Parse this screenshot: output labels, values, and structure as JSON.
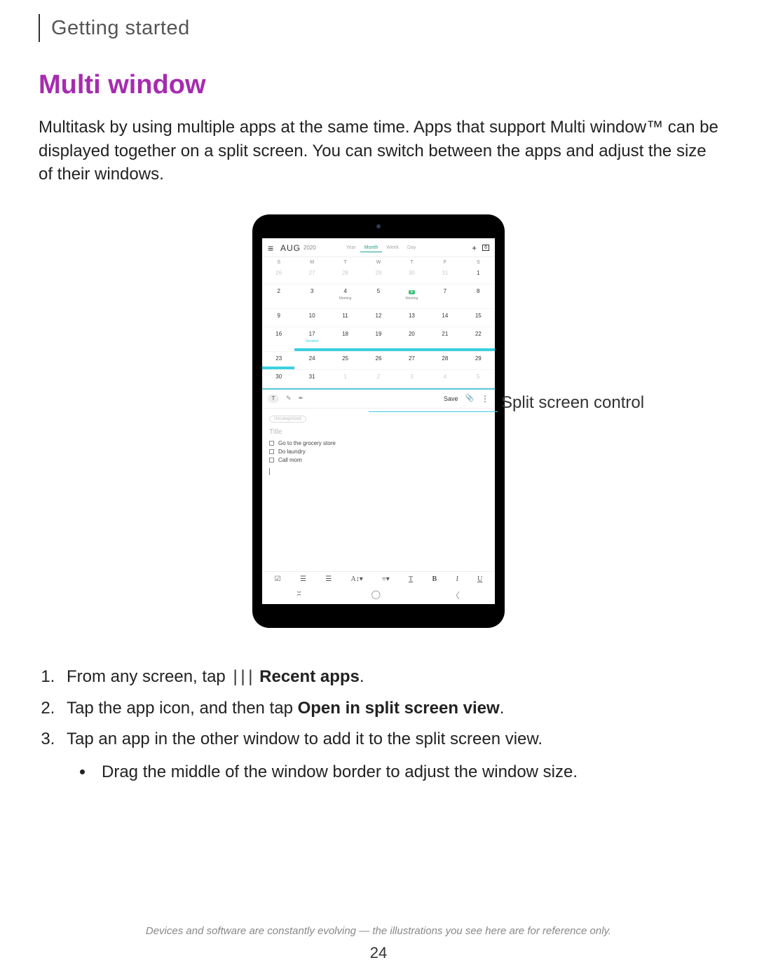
{
  "section": "Getting started",
  "title": "Multi window",
  "intro": "Multitask by using multiple apps at the same time. Apps that support Multi window™ can be displayed together on a split screen. You can switch between the apps and adjust the size of their windows.",
  "callout": "Split screen control",
  "tablet": {
    "cal": {
      "month": "AUG",
      "year": "2020",
      "tabs": [
        "Year",
        "Month",
        "Week",
        "Day"
      ],
      "today": "6",
      "dow": [
        "S",
        "M",
        "T",
        "W",
        "T",
        "F",
        "S"
      ],
      "row0": [
        "26",
        "27",
        "28",
        "29",
        "30",
        "31",
        "1"
      ],
      "row1": [
        "2",
        "3",
        "4",
        "5",
        "6",
        "7",
        "8"
      ],
      "row1_meet_a": "Meeting",
      "row1_meet_b": "Meeting",
      "row2": [
        "9",
        "10",
        "11",
        "12",
        "13",
        "14",
        "15"
      ],
      "row3": [
        "16",
        "17",
        "18",
        "19",
        "20",
        "21",
        "22"
      ],
      "row3_tag": "Vacation",
      "row4": [
        "23",
        "24",
        "25",
        "26",
        "27",
        "28",
        "29"
      ],
      "row5": [
        "30",
        "31",
        "1",
        "2",
        "3",
        "4",
        "5"
      ]
    },
    "notes": {
      "save": "Save",
      "chip": "Uncategorized",
      "title_ph": "Title",
      "todos": [
        "Go to the grocery store",
        "Do laundry",
        "Call mom"
      ]
    }
  },
  "steps": {
    "s1a": "From any screen, tap",
    "s1b": "Recent apps",
    "s2a": "Tap the app icon, and then tap ",
    "s2b": "Open in split screen view",
    "s3": "Tap an app in the other window to add it to the split screen view.",
    "s3sub": "Drag the middle of the window border to adjust the window size."
  },
  "disclaimer": "Devices and software are constantly evolving — the illustrations you see here are for reference only.",
  "page": "24"
}
